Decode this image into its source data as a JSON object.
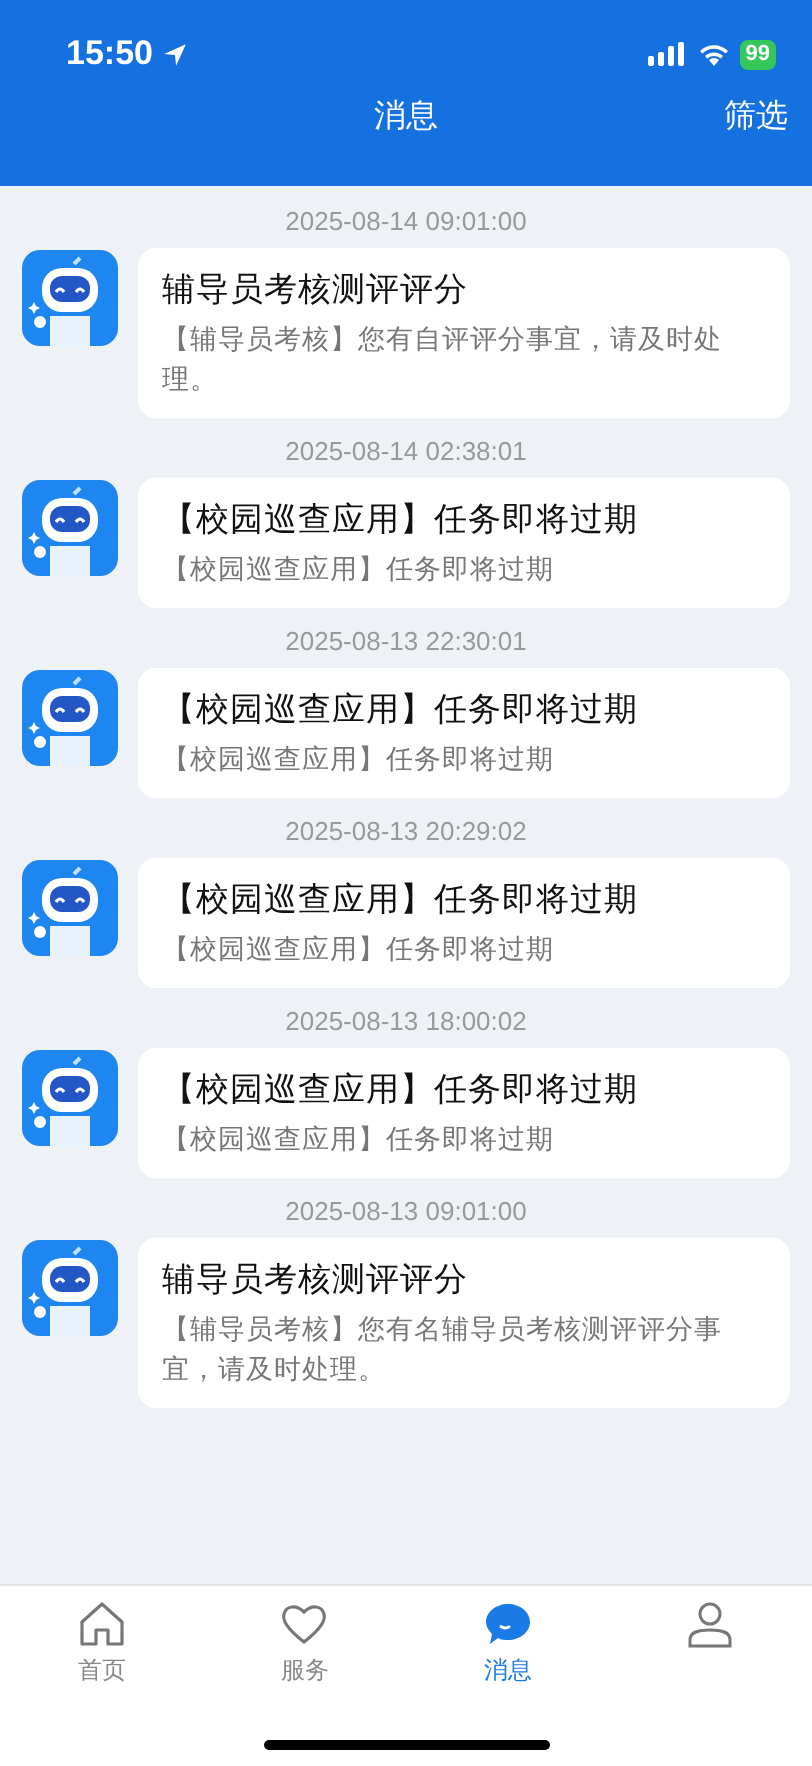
{
  "status_bar": {
    "time": "15:50",
    "battery": "99"
  },
  "header": {
    "title": "消息",
    "action": "筛选"
  },
  "messages": [
    {
      "time": "2025-08-14 09:01:00",
      "title": "辅导员考核测评评分",
      "body": "【辅导员考核】您有自评评分事宜，请及时处理。"
    },
    {
      "time": "2025-08-14 02:38:01",
      "title": "【校园巡查应用】任务即将过期",
      "body": "【校园巡查应用】任务即将过期"
    },
    {
      "time": "2025-08-13 22:30:01",
      "title": "【校园巡查应用】任务即将过期",
      "body": "【校园巡查应用】任务即将过期"
    },
    {
      "time": "2025-08-13 20:29:02",
      "title": "【校园巡查应用】任务即将过期",
      "body": "【校园巡查应用】任务即将过期"
    },
    {
      "time": "2025-08-13 18:00:02",
      "title": "【校园巡查应用】任务即将过期",
      "body": "【校园巡查应用】任务即将过期"
    },
    {
      "time": "2025-08-13 09:01:00",
      "title": "辅导员考核测评评分",
      "body": "【辅导员考核】您有名辅导员考核测评评分事宜，请及时处理。"
    }
  ],
  "tabs": [
    {
      "kind": "home",
      "label": "首页",
      "selected": false
    },
    {
      "kind": "service",
      "label": "服务",
      "selected": false
    },
    {
      "kind": "message",
      "label": "消息",
      "selected": true
    },
    {
      "kind": "profile",
      "selected": false
    }
  ]
}
